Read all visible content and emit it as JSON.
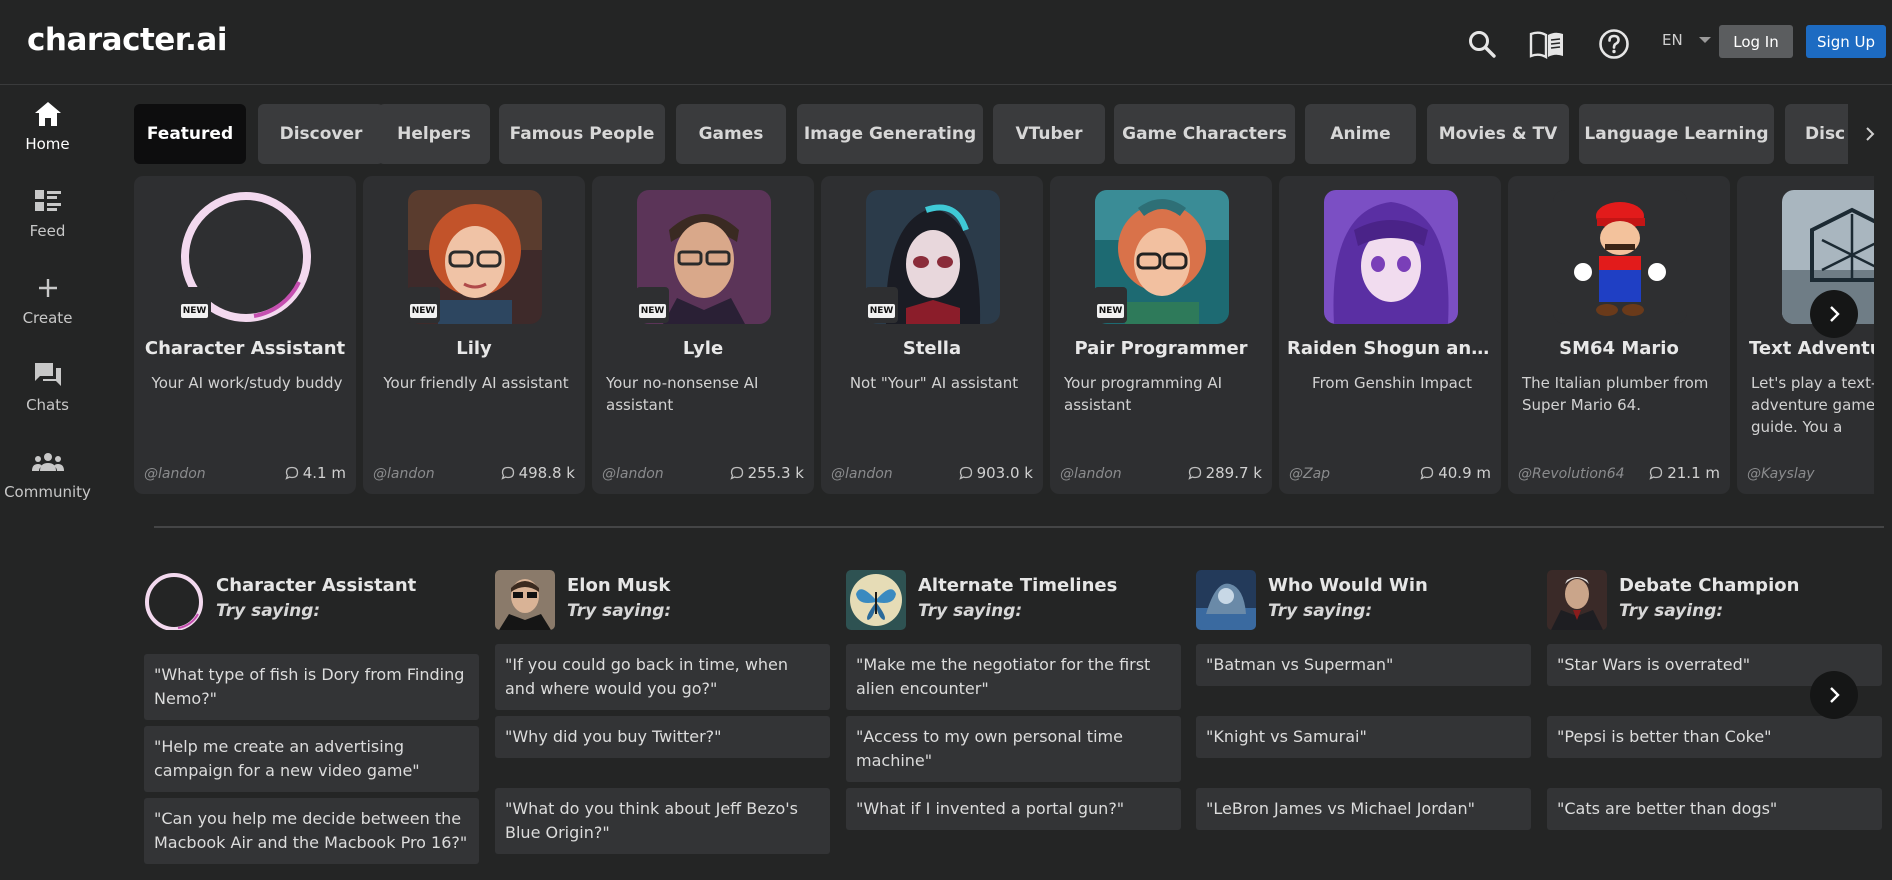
{
  "header": {
    "logo": "character.ai",
    "icons": [
      "search-icon",
      "book-icon",
      "help-icon"
    ],
    "language": "EN",
    "login_label": "Log In",
    "signup_label": "Sign Up"
  },
  "sidebar": {
    "items": [
      {
        "label": "Home",
        "icon": "home-icon"
      },
      {
        "label": "Feed",
        "icon": "feed-icon"
      },
      {
        "label": "Create",
        "icon": "plus-icon"
      },
      {
        "label": "Chats",
        "icon": "chat-icon"
      },
      {
        "label": "Community",
        "icon": "community-icon"
      }
    ]
  },
  "tabs": [
    "Featured",
    "Discover",
    "Helpers",
    "Famous People",
    "Games",
    "Image Generating",
    "VTuber",
    "Game Characters",
    "Anime",
    "Movies & TV",
    "Language Learning",
    "Disc"
  ],
  "new_badge": "NEW",
  "cards": [
    {
      "name": "Character Assistant",
      "desc": "Your AI work/study buddy",
      "author": "@landon",
      "count": "4.1 m"
    },
    {
      "name": "Lily",
      "desc": "Your friendly AI assistant",
      "author": "@landon",
      "count": "498.8 k"
    },
    {
      "name": "Lyle",
      "desc": "Your no-nonsense AI assistant",
      "author": "@landon",
      "count": "255.3 k"
    },
    {
      "name": "Stella",
      "desc": "Not \"Your\" AI assistant",
      "author": "@landon",
      "count": "903.0 k"
    },
    {
      "name": "Pair Programmer",
      "desc": "Your programming AI assistant",
      "author": "@landon",
      "count": "289.7 k"
    },
    {
      "name": "Raiden Shogun and...",
      "desc": "From Genshin Impact",
      "author": "@Zap",
      "count": "40.9 m"
    },
    {
      "name": "SM64 Mario",
      "desc": "The Italian plumber from Super Mario 64.",
      "author": "@Revolution64",
      "count": "21.1 m"
    },
    {
      "name": "Text Adventu",
      "desc": "Let's play a text-b adventure game. your guide. You a",
      "author": "@Kayslay",
      "count": ""
    }
  ],
  "try_saying": {
    "label": "Try saying:",
    "columns": [
      {
        "name": "Character Assistant",
        "prompts": [
          "\"What type of fish is Dory from Finding Nemo?\"",
          "\"Help me create an advertising campaign for a new video game\"",
          "\"Can you help me decide between the Macbook Air and the Macbook Pro 16?\""
        ]
      },
      {
        "name": "Elon Musk",
        "prompts": [
          "\"If you could go back in time, when and where would you go?\"",
          "\"Why did you buy Twitter?\"",
          "\"What do you think about Jeff Bezo's Blue Origin?\""
        ]
      },
      {
        "name": "Alternate Timelines",
        "prompts": [
          "\"Make me the negotiator for the first alien encounter\"",
          "\"Access to my own personal time machine\"",
          "\"What if I invented a portal gun?\""
        ]
      },
      {
        "name": "Who Would Win",
        "prompts": [
          "\"Batman vs Superman\"",
          "\"Knight vs Samurai\"",
          "\"LeBron James vs Michael Jordan\""
        ]
      },
      {
        "name": "Debate Champion",
        "prompts": [
          "\"Star Wars is overrated\"",
          "\"Pepsi is better than Coke\"",
          "\"Cats are better than dogs\""
        ]
      }
    ]
  },
  "colors": {
    "background": "#242525",
    "card": "#2e2f31",
    "tab": "#3a3b3d",
    "tab_active": "#0d0d0e",
    "signup": "#1d6bc2",
    "login": "#5b5d5f"
  }
}
